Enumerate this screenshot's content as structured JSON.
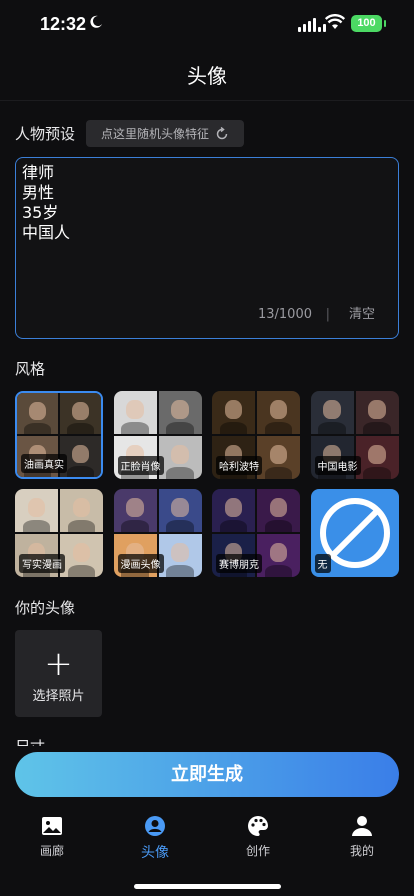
{
  "status": {
    "time": "12:32",
    "battery": "100"
  },
  "header": {
    "title": "头像"
  },
  "preset": {
    "label": "人物预设",
    "random_button": "点这里随机头像特征",
    "text": "律师\n男性\n35岁\n中国人",
    "counter": "13/1000",
    "separator": "|",
    "clear": "清空"
  },
  "style": {
    "label": "风格",
    "items": [
      {
        "label": "油画真实",
        "selected": true,
        "colors": [
          "#5a4a3a",
          "#3c3326",
          "#6a5544",
          "#2d2a28"
        ]
      },
      {
        "label": "正脸肖像",
        "selected": false,
        "colors": [
          "#d8d8d8",
          "#6a6a6a",
          "#e6e6e6",
          "#bcbcbc"
        ]
      },
      {
        "label": "哈利波特",
        "selected": false,
        "colors": [
          "#3a2a18",
          "#4a3520",
          "#2e2214",
          "#5a4028"
        ]
      },
      {
        "label": "中国电影",
        "selected": false,
        "colors": [
          "#2a2e38",
          "#3a2628",
          "#222630",
          "#4a2228"
        ]
      },
      {
        "label": "写实漫画",
        "selected": false,
        "colors": [
          "#d8cfc0",
          "#c8bca8",
          "#bfb29e",
          "#d0c4b0"
        ]
      },
      {
        "label": "漫画头像",
        "selected": false,
        "colors": [
          "#4a3a6a",
          "#3a4a8a",
          "#e0a060",
          "#b0c8e8"
        ]
      },
      {
        "label": "赛博朋克",
        "selected": false,
        "colors": [
          "#2a2050",
          "#3a1a4a",
          "#1a2048",
          "#4a2060"
        ]
      },
      {
        "label": "无",
        "selected": false,
        "colors": []
      }
    ]
  },
  "avatar": {
    "label": "你的头像",
    "select_photo": "选择照片",
    "add_icon": "+"
  },
  "cut_label": "尺寸",
  "generate": {
    "label": "立即生成"
  },
  "tabs": [
    {
      "label": "画廊",
      "icon": "image-icon",
      "active": false
    },
    {
      "label": "头像",
      "icon": "user-circle-icon",
      "active": true
    },
    {
      "label": "创作",
      "icon": "palette-icon",
      "active": false
    },
    {
      "label": "我的",
      "icon": "person-icon",
      "active": false
    }
  ]
}
